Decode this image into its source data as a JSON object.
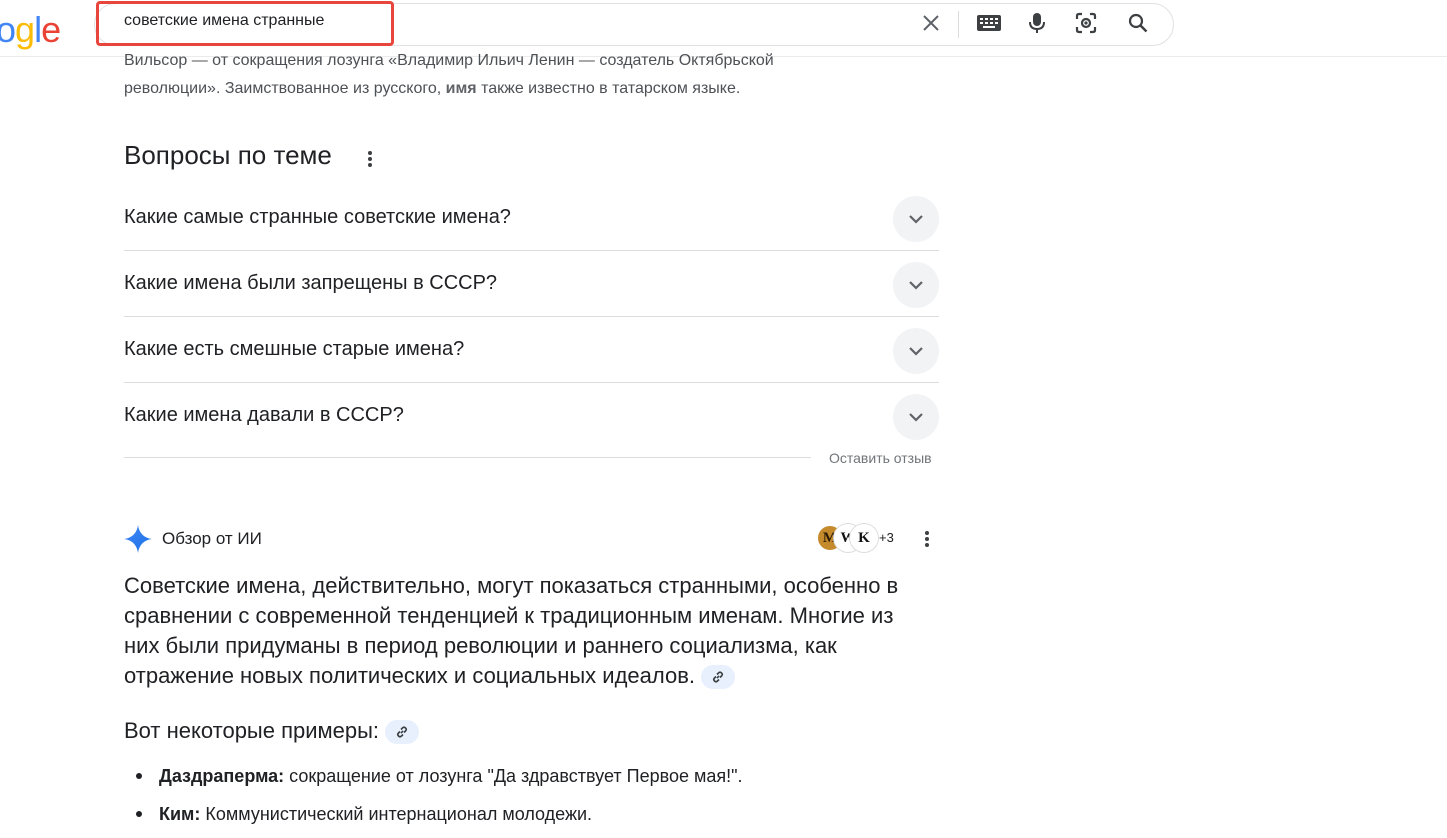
{
  "header": {
    "search_query": "советские имена странные",
    "logo_text": "ogle",
    "icons": [
      "clear-icon",
      "keyboard-icon",
      "microphone-icon",
      "lens-icon",
      "search-icon"
    ]
  },
  "snippet": {
    "line1": "Вильсор — от сокращения лозунга «Владимир Ильич Ленин — создатель Октябрьской",
    "line2_pre": "революции». Заимствованное из русского, ",
    "line2_bold": "имя",
    "line2_post": " также известно в татарском языке."
  },
  "related_questions": {
    "title": "Вопросы по теме",
    "items": [
      "Какие самые странные советские имена?",
      "Какие имена были запрещены в СССР?",
      "Какие есть смешные старые имена?",
      "Какие имена давали в СССР?"
    ],
    "feedback_label": "Оставить отзыв"
  },
  "ai_overview": {
    "label": "Обзор от ИИ",
    "source_icons": [
      "М",
      "W",
      "K"
    ],
    "more_sources": "+3",
    "paragraph": "Советские имена, действительно, могут показаться странными, особенно в сравнении с современной тенденцией к традиционным именам. Многие из них были придуманы в период революции и раннего социализма, как отражение новых политических и социальных идеалов.",
    "examples_heading": "Вот некоторые примеры:",
    "examples": [
      {
        "term": "Даздраперма:",
        "desc": " сокращение от лозунга \"Да здравствует Первое мая!\"."
      },
      {
        "term": "Ким:",
        "desc": " Коммунистический интернационал молодежи."
      }
    ]
  },
  "colors": {
    "accent_red": "#e8453c",
    "text": "#202124",
    "muted": "#4d5156",
    "chip_bg": "#e8f0fe"
  }
}
